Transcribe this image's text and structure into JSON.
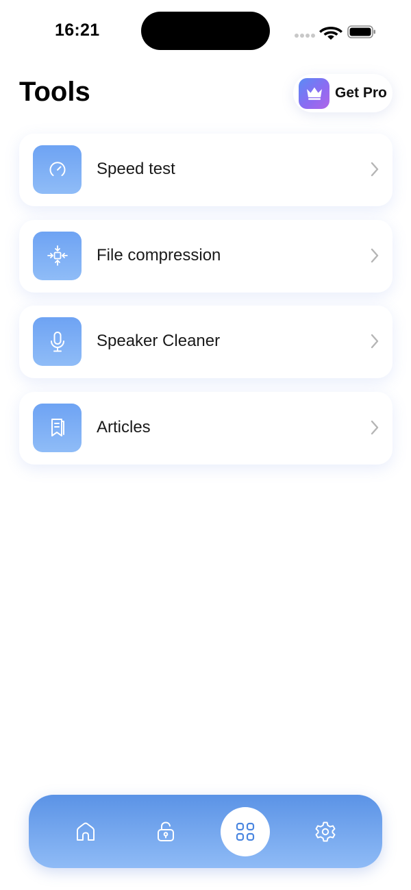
{
  "status_bar": {
    "time": "16:21"
  },
  "header": {
    "title": "Tools",
    "get_pro_label": "Get Pro",
    "get_pro_icon": "crown-icon"
  },
  "tools": [
    {
      "label": "Speed test",
      "icon": "speedometer-icon"
    },
    {
      "label": "File compression",
      "icon": "compress-icon"
    },
    {
      "label": "Speaker Cleaner",
      "icon": "microphone-icon"
    },
    {
      "label": "Articles",
      "icon": "book-icon"
    }
  ],
  "tab_bar": {
    "tabs": [
      {
        "icon": "home-icon",
        "active": false
      },
      {
        "icon": "unlock-icon",
        "active": false
      },
      {
        "icon": "grid-icon",
        "active": true
      },
      {
        "icon": "gear-icon",
        "active": false
      }
    ]
  },
  "colors": {
    "accent_blue": "#5b93e6",
    "icon_tile_top": "#6ea3f3",
    "icon_tile_bottom": "#8fbcf7",
    "chevron": "#b5b5b5",
    "crown_gradient_start": "#5a8cf5",
    "crown_gradient_end": "#b065e8"
  }
}
